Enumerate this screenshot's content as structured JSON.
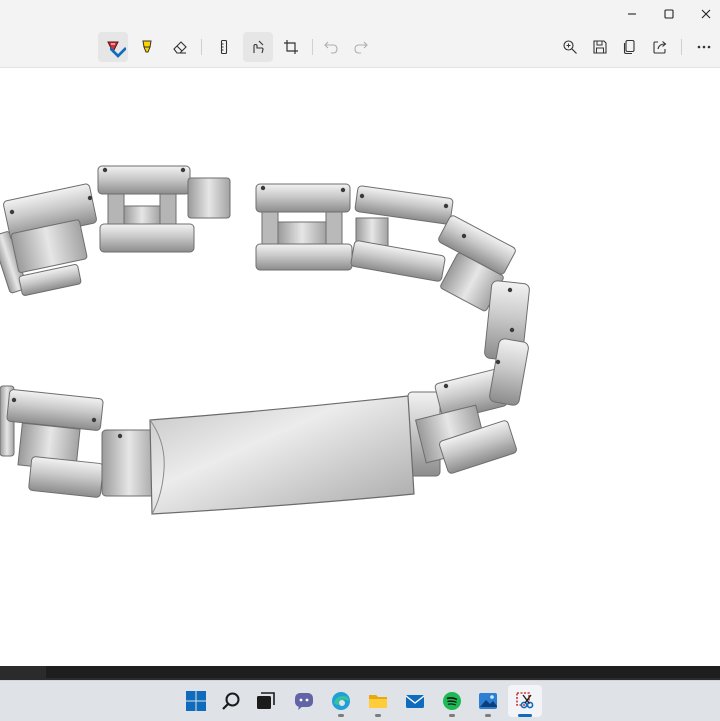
{
  "app": {
    "name": "Snipping Tool"
  },
  "window_controls": [
    {
      "name": "minimize",
      "icon": "minimize-icon"
    },
    {
      "name": "maximize",
      "icon": "maximize-icon"
    },
    {
      "name": "close",
      "icon": "close-icon"
    }
  ],
  "toolbar": {
    "left_tools": [
      {
        "name": "ballpoint-pen",
        "icon": "pen-icon",
        "color": "#d13438",
        "active": true
      },
      {
        "name": "highlighter",
        "icon": "highlighter-icon",
        "color": "#ffd400"
      },
      {
        "name": "eraser",
        "icon": "eraser-icon"
      },
      {
        "name": "ruler",
        "icon": "ruler-icon"
      },
      {
        "name": "touch-writing",
        "icon": "touch-writing-icon",
        "active": true
      },
      {
        "name": "crop",
        "icon": "crop-icon"
      },
      {
        "name": "undo",
        "icon": "undo-icon",
        "disabled": true
      },
      {
        "name": "redo",
        "icon": "redo-icon",
        "disabled": true
      }
    ],
    "right_tools": [
      {
        "name": "zoom",
        "icon": "zoom-in-icon"
      },
      {
        "name": "save",
        "icon": "save-icon"
      },
      {
        "name": "copy",
        "icon": "copy-icon"
      },
      {
        "name": "share",
        "icon": "share-icon"
      },
      {
        "name": "more",
        "icon": "more-icon"
      }
    ]
  },
  "canvas": {
    "image": "bracelet-image",
    "background": "#ffffff"
  },
  "taskbar": {
    "background": "#dfe3e8",
    "items": [
      {
        "name": "start",
        "icon": "windows-start-icon"
      },
      {
        "name": "search",
        "icon": "search-icon"
      },
      {
        "name": "task-view",
        "icon": "task-view-icon"
      },
      {
        "name": "chat",
        "icon": "chat-icon"
      },
      {
        "name": "edge",
        "icon": "edge-browser-icon",
        "running": true
      },
      {
        "name": "file-explorer",
        "icon": "folder-icon",
        "running": true
      },
      {
        "name": "mail",
        "icon": "mail-icon"
      },
      {
        "name": "spotify",
        "icon": "spotify-icon",
        "running": true
      },
      {
        "name": "photos",
        "icon": "photos-icon",
        "running": true
      },
      {
        "name": "snipping-tool",
        "icon": "snipping-tool-icon",
        "running": true,
        "active": true
      }
    ]
  },
  "colors": {
    "accent": "#0f6cbd",
    "chrome": "#f3f3f3"
  }
}
